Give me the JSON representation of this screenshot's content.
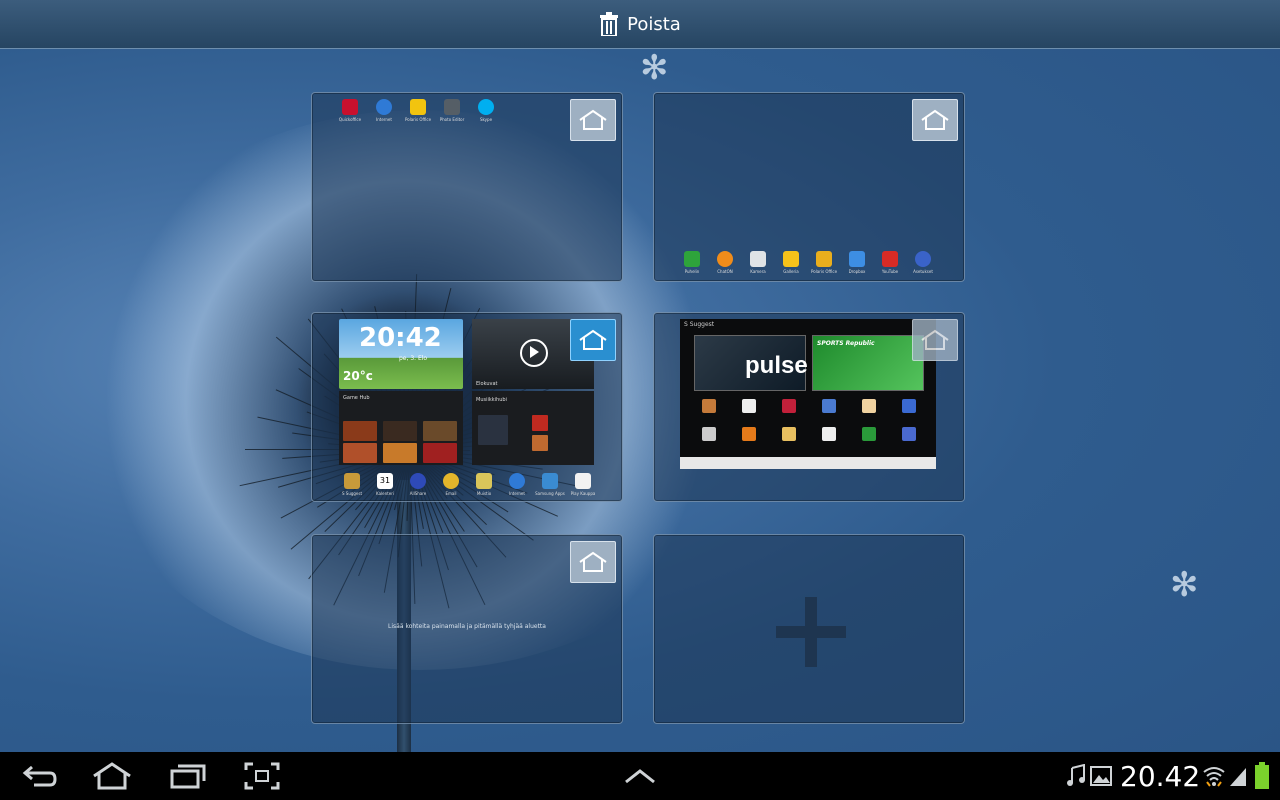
{
  "topbar": {
    "delete_label": "Poista"
  },
  "panels": [
    {
      "id": "page-1",
      "apps": [
        {
          "label": "Quickoffice",
          "icon": "quickoffice-icon",
          "color": "#c8102e"
        },
        {
          "label": "Internet",
          "icon": "globe-icon",
          "color": "#2f7ad6"
        },
        {
          "label": "Polaris Office",
          "icon": "chart-icon",
          "color": "#f2c40f"
        },
        {
          "label": "Photo Editor",
          "icon": "photo-editor-icon",
          "color": "#555e66"
        },
        {
          "label": "Skype",
          "icon": "skype-icon",
          "color": "#00aff0"
        }
      ]
    },
    {
      "id": "page-2",
      "apps": [
        {
          "label": "Puhelin",
          "icon": "phone-icon",
          "color": "#2ea43b"
        },
        {
          "label": "ChatON",
          "icon": "chat-icon",
          "color": "#f08c1a"
        },
        {
          "label": "Kamera",
          "icon": "camera-icon",
          "color": "#dfe3e6"
        },
        {
          "label": "Galleria",
          "icon": "gallery-icon",
          "color": "#f6c21a"
        },
        {
          "label": "Polaris Office",
          "icon": "office-icon",
          "color": "#e9ae1d"
        },
        {
          "label": "Dropbox",
          "icon": "dropbox-icon",
          "color": "#3d8ee3"
        },
        {
          "label": "YouTube",
          "icon": "youtube-icon",
          "color": "#d72b26"
        },
        {
          "label": "Asetukset",
          "icon": "settings-icon",
          "color": "#3a63c9"
        }
      ]
    },
    {
      "id": "page-3",
      "clock_widget": {
        "time": "20:42",
        "date": "pe, 3. Elo",
        "temp": "20°c"
      },
      "video_widget": {
        "title": "Elokuvat",
        "music_label": "Musiikkihubi"
      },
      "game_hub": {
        "title": "Game Hub"
      },
      "apps": [
        {
          "label": "S Suggest",
          "icon": "s-suggest-icon",
          "color": "#c89a3a"
        },
        {
          "label": "Kalenteri",
          "icon": "calendar-icon",
          "color": "#ffffff",
          "text": "31"
        },
        {
          "label": "AllShare",
          "icon": "allshare-icon",
          "color": "#2e4ab8"
        },
        {
          "label": "Email",
          "icon": "email-icon",
          "color": "#e3b52b"
        },
        {
          "label": "Muistio",
          "icon": "memo-icon",
          "color": "#d9c55a"
        },
        {
          "label": "Internet",
          "icon": "globe-icon",
          "color": "#2f7ad6"
        },
        {
          "label": "Samsung Apps",
          "icon": "samsung-apps-icon",
          "color": "#3a8bd2"
        },
        {
          "label": "Play Kauppa",
          "icon": "play-store-icon",
          "color": "#f2f2f2"
        }
      ]
    },
    {
      "id": "page-4",
      "suggest": {
        "title": "S Suggest",
        "pulse": "pulse",
        "sports": "SPORTS Republic"
      }
    },
    {
      "id": "page-5",
      "message": "Lisää kohteita painamalla ja pitämällä tyhjää aluetta"
    },
    {
      "id": "add-page"
    }
  ],
  "sysbar": {
    "clock": "20.42"
  },
  "colors": {
    "active_home": "#2a8fd0",
    "inactive_home": "#9eb0c2",
    "battery": "#7bd12c"
  }
}
